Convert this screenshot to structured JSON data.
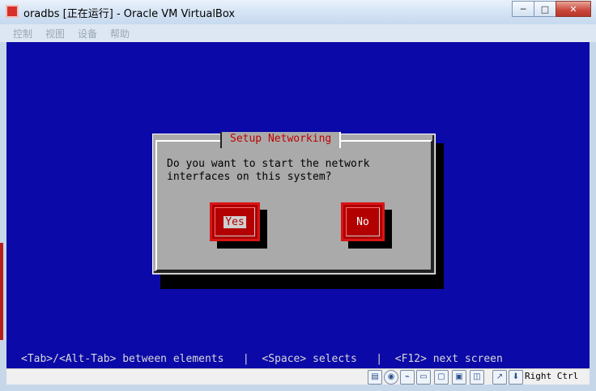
{
  "window": {
    "title": "oradbs [正在运行] - Oracle VM VirtualBox",
    "controls": {
      "minimize": "─",
      "maximize": "□",
      "close": "✕"
    }
  },
  "menu": [
    "控制",
    "视图",
    "设备",
    "帮助"
  ],
  "vm_screen": {
    "background_color": "#0b09a7",
    "dialog": {
      "title": "Setup Networking",
      "message": "Do you want to start the network\ninterfaces on this system?",
      "buttons": [
        {
          "label": "Yes",
          "focused": true
        },
        {
          "label": "No",
          "focused": false
        }
      ]
    },
    "help_line": "<Tab>/<Alt-Tab> between elements   |  <Space> selects   |  <F12> next screen"
  },
  "statusbar": {
    "icons": [
      "hard-disk-icon",
      "optical-drive-icon",
      "usb-icon",
      "shared-folder-icon",
      "display-icon",
      "network-icon",
      "video-capture-icon",
      "mouse-integration-icon",
      "host-key-arrow-icon"
    ],
    "host_key": "Right Ctrl"
  }
}
